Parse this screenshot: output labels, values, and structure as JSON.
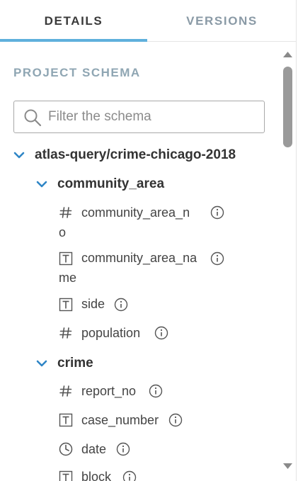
{
  "tabs": [
    {
      "label": "DETAILS",
      "active": true
    },
    {
      "label": "VERSIONS",
      "active": false
    }
  ],
  "schema": {
    "title": "PROJECT SCHEMA",
    "filter_placeholder": "Filter the schema",
    "filter_value": "",
    "dataset": "atlas-query/crime-chicago-2018",
    "tables": [
      {
        "name": "community_area",
        "fields": [
          {
            "line1": "community_area_n",
            "line2": "o",
            "type": "number"
          },
          {
            "line1": "community_area_na",
            "line2": "me",
            "type": "text"
          },
          {
            "line1": "side",
            "type": "text"
          },
          {
            "line1": "population",
            "type": "number"
          }
        ]
      },
      {
        "name": "crime",
        "fields": [
          {
            "line1": "report_no",
            "type": "number"
          },
          {
            "line1": "case_number",
            "type": "text"
          },
          {
            "line1": "date",
            "type": "datetime"
          },
          {
            "line1": "block",
            "type": "text"
          }
        ]
      }
    ]
  },
  "colors": {
    "accent": "#5fb0dc",
    "chevron": "#2f86c6",
    "section_title": "#8fa6b3",
    "inactive_tab": "#8a9aa6",
    "scroll_thumb": "#9a9a9a"
  }
}
